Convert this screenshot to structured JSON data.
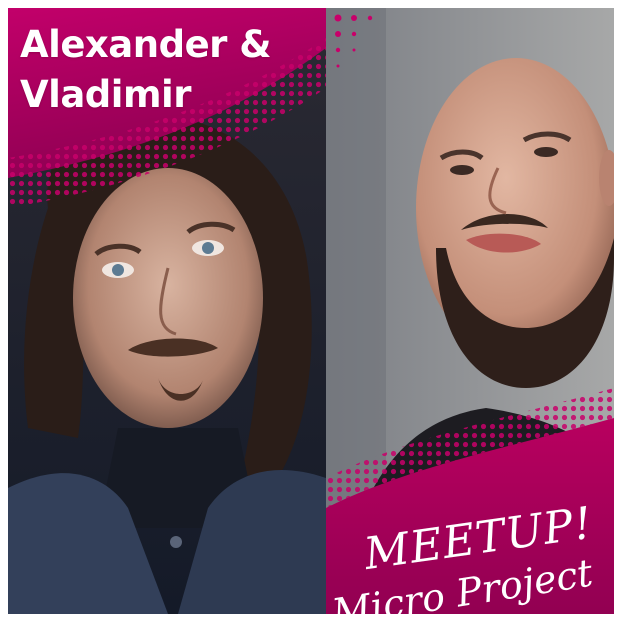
{
  "title": {
    "line1": "Alexander &",
    "line2": "Vladimir"
  },
  "badge": {
    "line1": "MEETUP!",
    "line2": "Micro Project"
  },
  "colors": {
    "accent": "#b5005e",
    "accent_light": "#d8107a",
    "left_background": "#1e2535",
    "right_background": "#8a8e92"
  },
  "photos": {
    "left": "portrait-man-long-hair",
    "right": "portrait-man-beard"
  }
}
